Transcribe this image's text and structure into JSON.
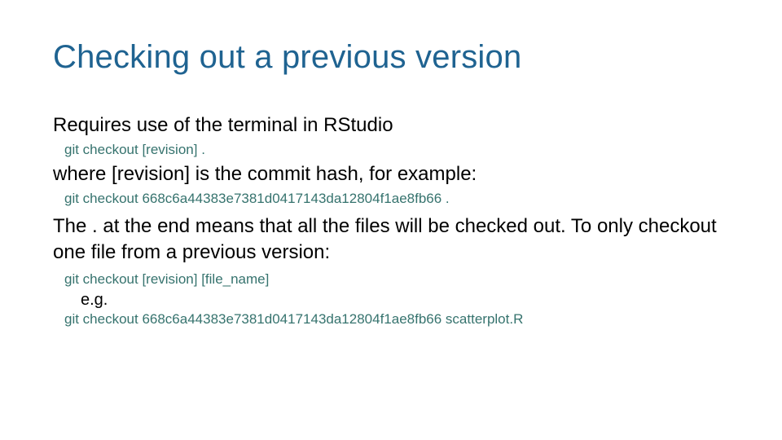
{
  "title": "Checking out a previous version",
  "line1": "Requires use of the terminal in RStudio",
  "code1": "git checkout [revision] .",
  "line2": "where [revision] is the commit hash, for example:",
  "code2": "git checkout 668c6a44383e7381d0417143da12804f1ae8fb66 .",
  "line3": "The . at the end means that all the files will be checked out. To only checkout one file from a previous version:",
  "code3": "git checkout [revision] [file_name]",
  "eg": "e.g.",
  "code4": "git checkout 668c6a44383e7381d0417143da12804f1ae8fb66 scatterplot.R"
}
